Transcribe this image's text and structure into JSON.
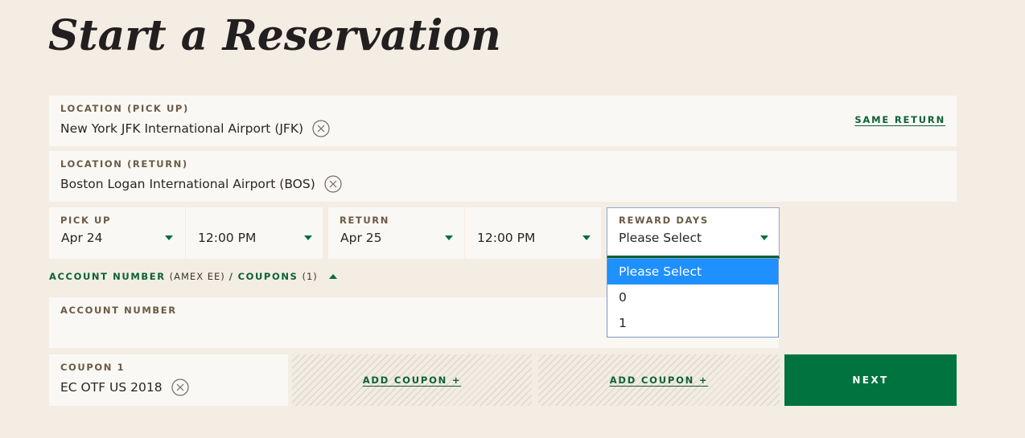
{
  "page": {
    "title": "Start a Reservation"
  },
  "pickup_location": {
    "label": "LOCATION (PICK UP)",
    "value": "New York JFK International Airport (JFK)",
    "same_return_label": "SAME RETURN"
  },
  "return_location": {
    "label": "LOCATION (RETURN)",
    "value": "Boston Logan International Airport (BOS)"
  },
  "pickup": {
    "label": "PICK UP",
    "date": "Apr 24",
    "time": "12:00 PM"
  },
  "return": {
    "label": "RETURN",
    "date": "Apr 25",
    "time": "12:00 PM"
  },
  "reward_days": {
    "label": "REWARD DAYS",
    "value": "Please Select",
    "options": [
      "Please Select",
      "0",
      "1"
    ],
    "selected_index": 0
  },
  "account_toggle": {
    "account_label": "ACCOUNT NUMBER",
    "account_value": "(AMEX EE)",
    "separator": "/",
    "coupons_label": "COUPONS",
    "coupons_count": "(1)"
  },
  "account_number": {
    "label": "ACCOUNT NUMBER",
    "value": ""
  },
  "coupon1": {
    "label": "COUPON 1",
    "value": "EC OTF US 2018"
  },
  "add_coupon": {
    "label_1": "ADD COUPON +",
    "label_2": "ADD COUPON +"
  },
  "actions": {
    "next_label": "NEXT"
  },
  "colors": {
    "background": "#f4ede4",
    "field_bg": "#faf8f5",
    "brand_green": "#00733e",
    "link_green": "#0b6236",
    "label_brown": "#6b5a45",
    "option_highlight": "#1e90ff"
  }
}
